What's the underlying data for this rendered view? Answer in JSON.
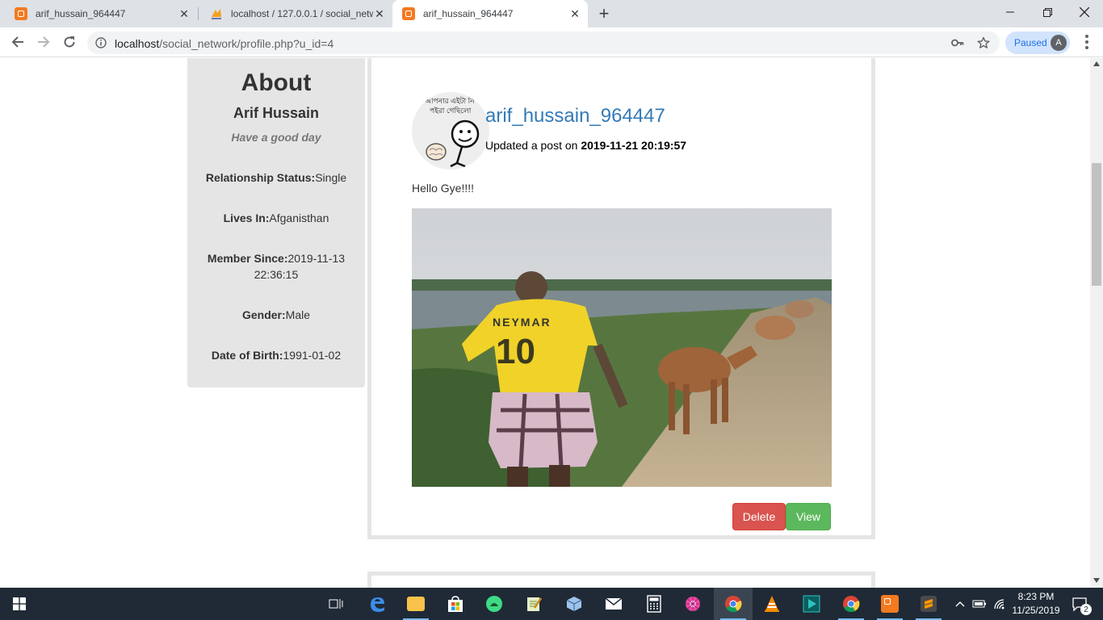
{
  "browser": {
    "tabs": [
      {
        "title": "arif_hussain_964447",
        "active": false
      },
      {
        "title": "localhost / 127.0.0.1 / social_netw",
        "active": false
      },
      {
        "title": "arif_hussain_964447",
        "active": true
      }
    ],
    "new_tab": "+",
    "url_host": "localhost",
    "url_path": "/social_network/profile.php?u_id=4",
    "paused_label": "Paused",
    "avatar_letter": "A"
  },
  "about": {
    "heading": "About",
    "name": "Arif Hussain",
    "motto": "Have a good day",
    "fields": [
      {
        "label": "Relationship Status:",
        "value": "Single"
      },
      {
        "label": "Lives In:",
        "value": "Afganisthan"
      },
      {
        "label": "Member Since:",
        "value": "2019-11-13 22:36:15"
      },
      {
        "label": "Gender:",
        "value": "Male"
      },
      {
        "label": "Date of Birth:",
        "value": "1991-01-02"
      }
    ]
  },
  "post": {
    "username": "arif_hussain_964447",
    "action_text": "Updated a post on ",
    "date": "2019-11-21 20:19:57",
    "body": "Hello Gye!!!!",
    "avatar_caption_line1": "আপনার এইটা নি",
    "avatar_caption_line2": "পইরা গেছিলো",
    "shirt_name": "NEYMAR",
    "shirt_number": "10",
    "delete_label": "Delete",
    "view_label": "View"
  },
  "colors": {
    "link": "#337ab7",
    "danger": "#d9534f",
    "success": "#5cb85c",
    "sidebar_bg": "#e5e5e5"
  },
  "taskbar": {
    "time": "8:23 PM",
    "date": "11/25/2019",
    "notifications": "2"
  }
}
